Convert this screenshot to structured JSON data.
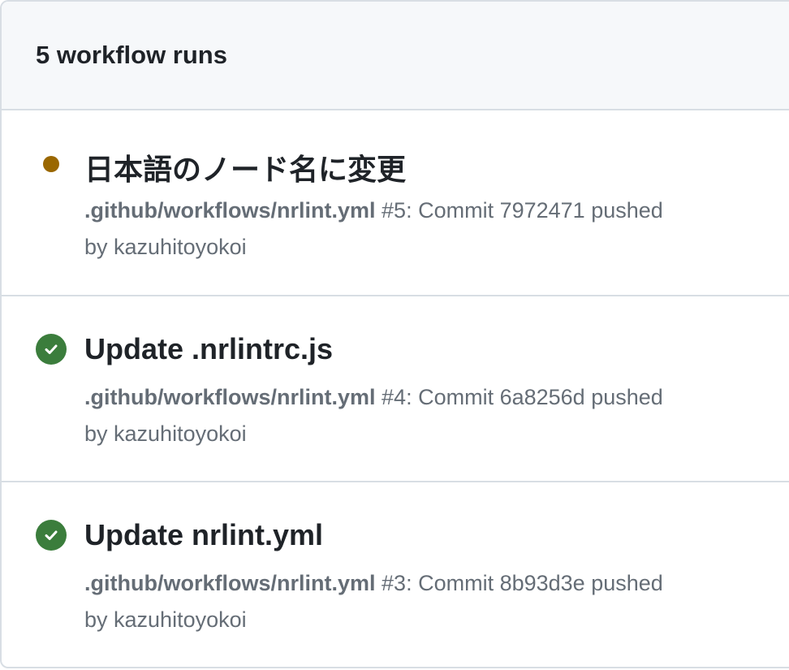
{
  "header": {
    "title": "5 workflow runs"
  },
  "colors": {
    "in_progress": "#9a6700",
    "success": "#3b7d3c",
    "border": "#d8dee4",
    "header_bg": "#f6f8fa",
    "text_primary": "#1f2328",
    "text_muted": "#656d76"
  },
  "runs": [
    {
      "status": "in-progress",
      "status_icon": "dot-icon",
      "title": "日本語のノード名に変更",
      "workflow_path": ".github/workflows/nrlint.yml",
      "run_number": "#5",
      "description": ": Commit 7972471 pushed",
      "actor_line": "by kazuhitoyokoi"
    },
    {
      "status": "success",
      "status_icon": "check-circle-icon",
      "title": "Update .nrlintrc.js",
      "workflow_path": ".github/workflows/nrlint.yml",
      "run_number": "#4",
      "description": ": Commit 6a8256d pushed",
      "actor_line": "by kazuhitoyokoi"
    },
    {
      "status": "success",
      "status_icon": "check-circle-icon",
      "title": "Update nrlint.yml",
      "workflow_path": ".github/workflows/nrlint.yml",
      "run_number": "#3",
      "description": ": Commit 8b93d3e pushed",
      "actor_line": "by kazuhitoyokoi"
    }
  ]
}
